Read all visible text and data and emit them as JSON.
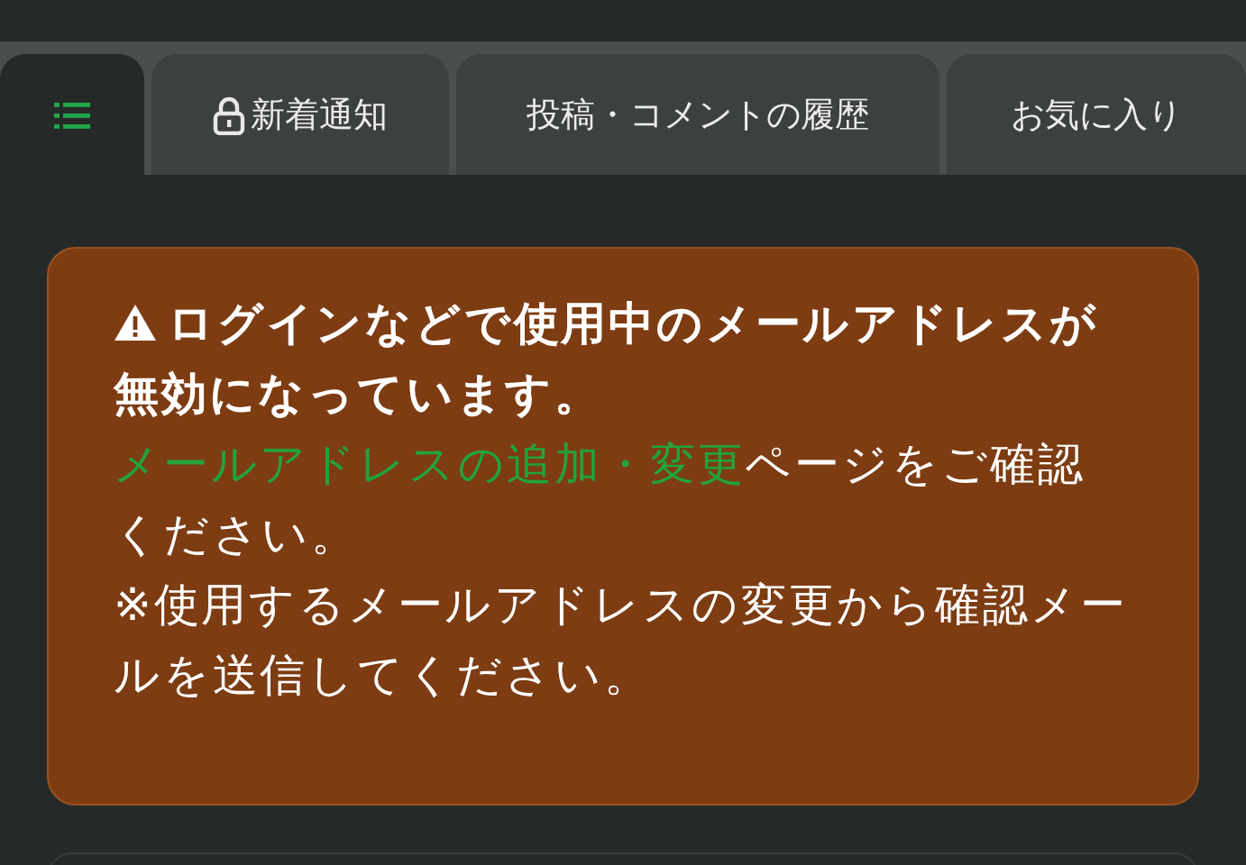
{
  "tabs": [
    {
      "kind": "menu",
      "selected": true
    },
    {
      "kind": "locked",
      "label": "新着通知",
      "selected": false
    },
    {
      "kind": "text",
      "label": "投稿・コメントの履歴",
      "selected": false
    },
    {
      "kind": "text",
      "label": "お気に入り",
      "selected": false
    }
  ],
  "alert": {
    "title": "ログインなどで使用中のメールアドレスが無効になっています。",
    "link": "メールアドレスの追加・変更",
    "text": "ページをご確認ください。",
    "note": "※使用するメールアドレスの変更から確認メールを送信してください。"
  }
}
